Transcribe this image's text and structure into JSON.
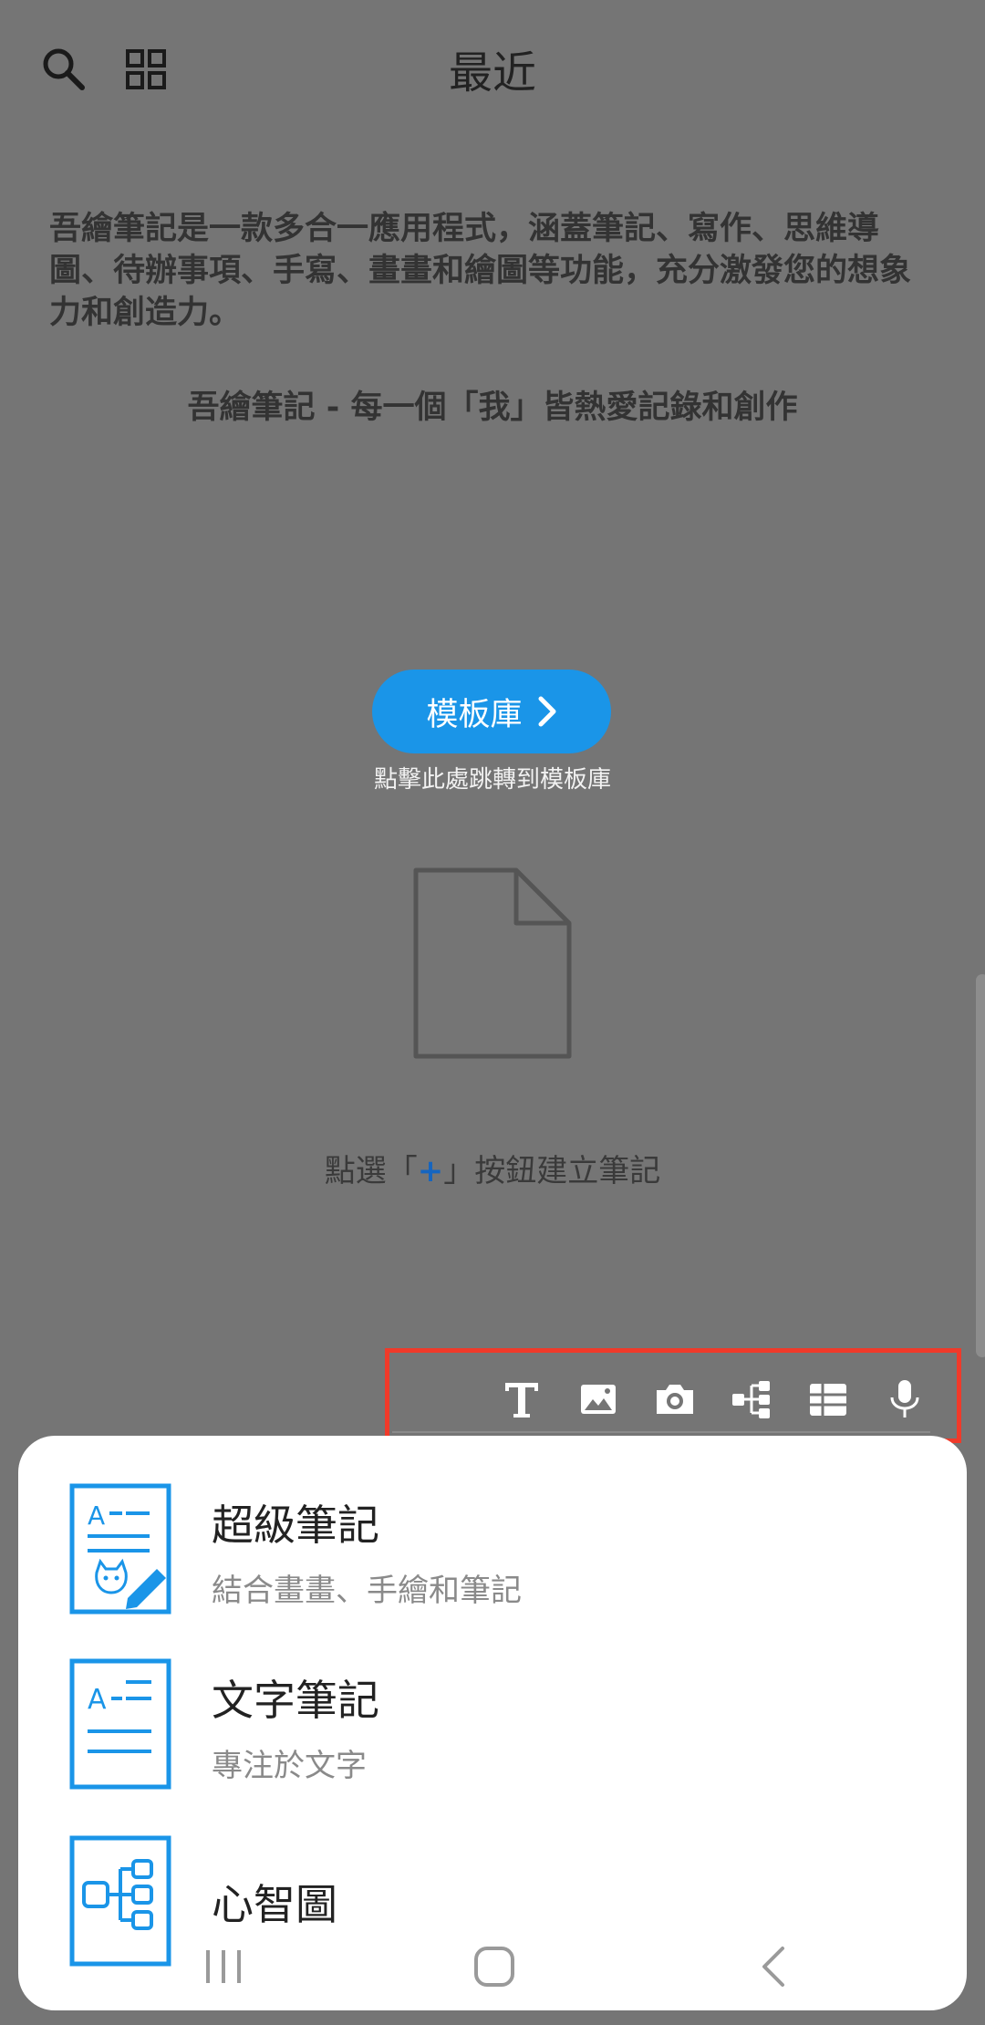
{
  "header": {
    "title": "最近",
    "search_icon": "search-icon",
    "grid_icon": "grid-view-icon"
  },
  "intro": {
    "description": "吾繪筆記是一款多合一應用程式，涵蓋筆記、寫作、思維導圖、待辦事項、手寫、畫畫和繪圖等功能，充分激發您的想象力和創造力。",
    "slogan": "吾繪筆記 - 每一個「我」皆熱愛記錄和創作"
  },
  "template": {
    "button_label": "模板庫",
    "hint": "點擊此處跳轉到模板庫"
  },
  "empty_state": {
    "hint_before": "點選「",
    "plus": "+",
    "hint_after": "」按鈕建立筆記"
  },
  "toolbar": {
    "icons": [
      "text-icon",
      "image-icon",
      "camera-icon",
      "mindmap-icon",
      "table-icon",
      "mic-icon"
    ],
    "highlight_color": "#f03a2a"
  },
  "sheet": {
    "items": [
      {
        "title": "超級筆記",
        "subtitle": "結合畫畫、手繪和筆記"
      },
      {
        "title": "文字筆記",
        "subtitle": "專注於文字"
      },
      {
        "title": "心智圖",
        "subtitle": ""
      }
    ]
  },
  "colors": {
    "accent": "#1a95e8",
    "overlay": "#757575"
  }
}
